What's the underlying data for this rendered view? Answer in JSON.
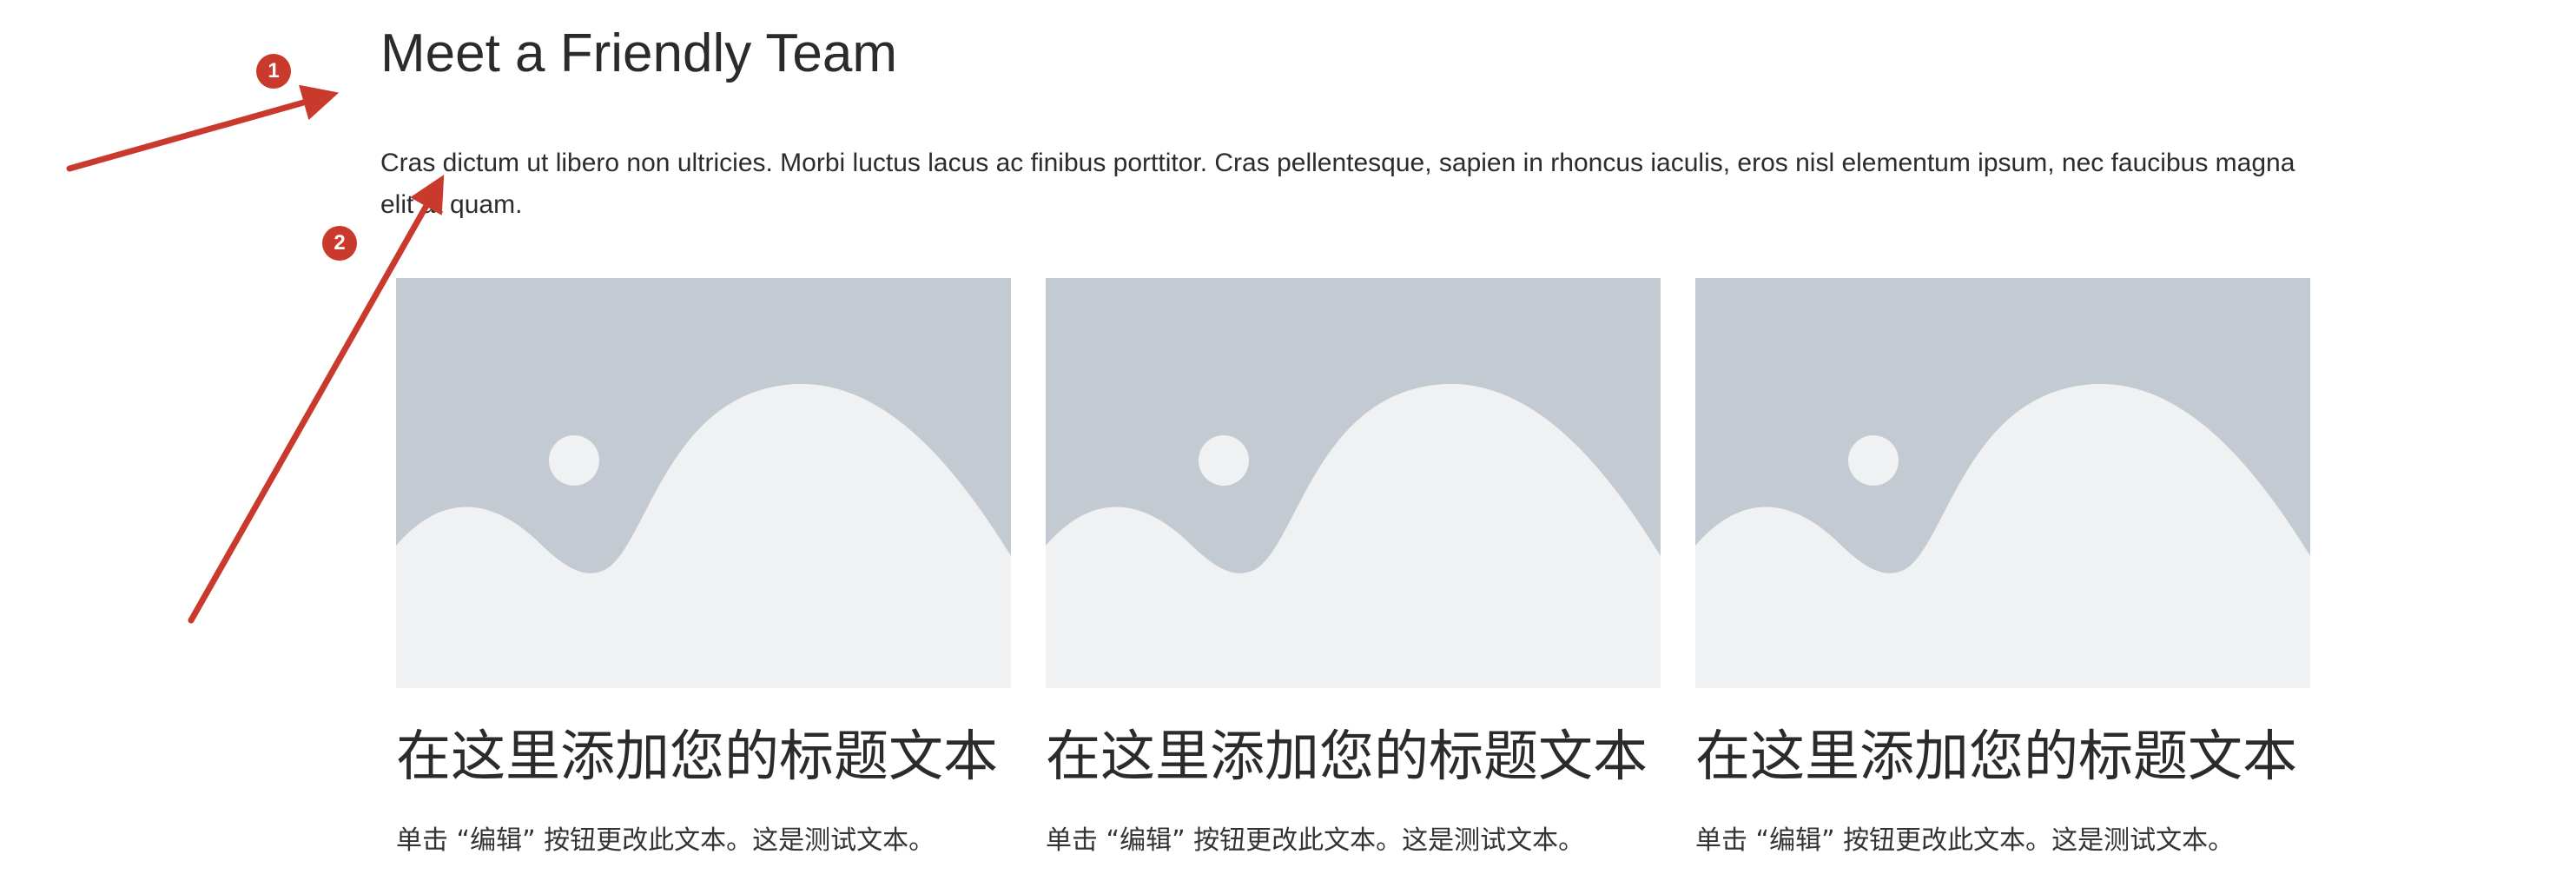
{
  "section": {
    "title": "Meet a Friendly Team",
    "intro": "Cras dictum ut libero non ultricies. Morbi luctus lacus ac finibus porttitor. Cras pellentesque, sapien in rhoncus iaculis, eros nisl elementum ipsum, nec faucibus magna elit at quam."
  },
  "cards": [
    {
      "title": "在这里添加您的标题文本",
      "text": "单击 “编辑” 按钮更改此文本。这是测试文本。",
      "image_icon": "image-placeholder-icon"
    },
    {
      "title": "在这里添加您的标题文本",
      "text": "单击 “编辑” 按钮更改此文本。这是测试文本。",
      "image_icon": "image-placeholder-icon"
    },
    {
      "title": "在这里添加您的标题文本",
      "text": "单击 “编辑” 按钮更改此文本。这是测试文本。",
      "image_icon": "image-placeholder-icon"
    }
  ],
  "annotations": [
    {
      "label": "1",
      "icon": "arrow-icon"
    },
    {
      "label": "2",
      "icon": "arrow-icon"
    }
  ],
  "colors": {
    "annotation_red": "#c9392c",
    "placeholder_sky": "#c3cad1",
    "placeholder_ground": "#f0f1f2"
  }
}
